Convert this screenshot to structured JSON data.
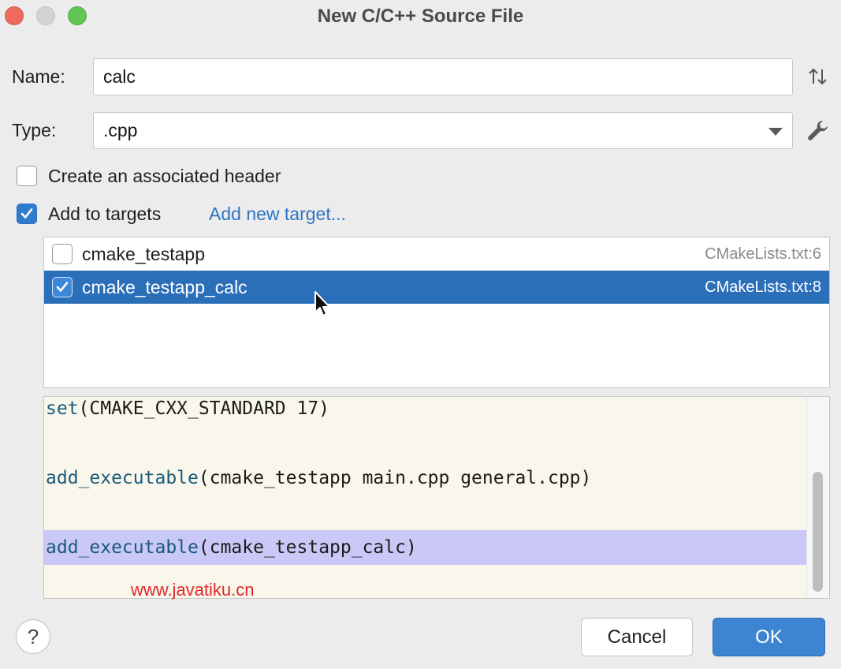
{
  "window": {
    "title": "New C/C++ Source File"
  },
  "name": {
    "label": "Name:",
    "value": "calc"
  },
  "type": {
    "label": "Type:",
    "value": ".cpp"
  },
  "associated_header": {
    "label": "Create an associated header",
    "checked": false
  },
  "add_targets": {
    "label": "Add to targets",
    "checked": true,
    "link": "Add new target..."
  },
  "targets": [
    {
      "name": "cmake_testapp",
      "file": "CMakeLists.txt:6",
      "checked": false,
      "selected": false
    },
    {
      "name": "cmake_testapp_calc",
      "file": "CMakeLists.txt:8",
      "checked": true,
      "selected": true
    }
  ],
  "code_preview": {
    "lines": [
      {
        "keyword": "set",
        "rest": "(CMAKE_CXX_STANDARD 17)"
      },
      {
        "keyword": "",
        "rest": ""
      },
      {
        "keyword": "add_executable",
        "rest": "(cmake_testapp main.cpp general.cpp)"
      },
      {
        "keyword": "",
        "rest": ""
      },
      {
        "keyword": "add_executable",
        "rest": "(cmake_testapp_calc)"
      }
    ]
  },
  "watermark": "www.javatiku.cn",
  "buttons": {
    "help": "?",
    "cancel": "Cancel",
    "ok": "OK"
  },
  "colors": {
    "accent": "#2c6fb9",
    "ok_button": "#3d85d3",
    "highlight_line": "#c9c8f6",
    "keyword": "#1b5a7a"
  },
  "icons": [
    "sort-icon",
    "wrench-icon",
    "dropdown-arrow-icon",
    "checkmark-icon",
    "mouse-cursor-icon"
  ]
}
